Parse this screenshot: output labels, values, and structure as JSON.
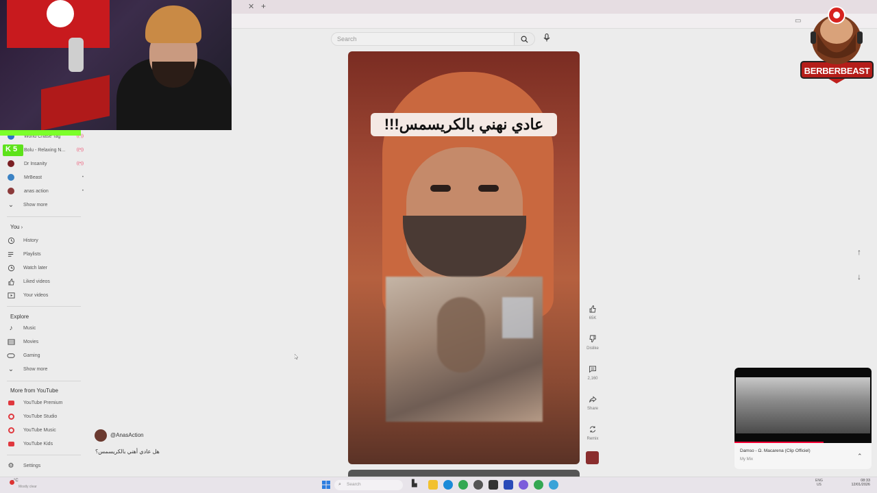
{
  "header": {
    "search_placeholder": "Search"
  },
  "overlay": {
    "brand": "BERBERBEAST",
    "kick_label": "5"
  },
  "sidebar": {
    "subscriptions": [
      {
        "label": "World Chase Tag",
        "color": "#2d72c9",
        "live": "((•))"
      },
      {
        "label": "Bolu - Relaxing N...",
        "color": "#5a5a5a",
        "live": "((•))"
      },
      {
        "label": "Dr Insanity",
        "color": "#7a1f24",
        "live": "((•))"
      },
      {
        "label": "MrBeast",
        "color": "#3b82c4",
        "live": "•"
      },
      {
        "label": "anas action",
        "color": "#8b3a3a",
        "live": "•"
      }
    ],
    "show_more_1": "Show more",
    "you_title": "You",
    "you_items": [
      {
        "label": "History",
        "icon": "history-icon"
      },
      {
        "label": "Playlists",
        "icon": "playlists-icon"
      },
      {
        "label": "Watch later",
        "icon": "watch-later-icon"
      },
      {
        "label": "Liked videos",
        "icon": "liked-videos-icon"
      },
      {
        "label": "Your videos",
        "icon": "your-videos-icon"
      }
    ],
    "explore_title": "Explore",
    "explore_items": [
      {
        "label": "Music",
        "icon": "music-icon"
      },
      {
        "label": "Movies",
        "icon": "movies-icon"
      },
      {
        "label": "Gaming",
        "icon": "gaming-icon"
      }
    ],
    "show_more_2": "Show more",
    "more_title": "More from YouTube",
    "more_items": [
      {
        "label": "YouTube Premium"
      },
      {
        "label": "YouTube Studio"
      },
      {
        "label": "YouTube Music"
      },
      {
        "label": "YouTube Kids"
      }
    ],
    "settings": "Settings"
  },
  "short": {
    "caption": "عادي نهني بالكريسمس!!!",
    "channel": "@AnasAction",
    "title": "هل عادي أهني بالكريسمس؟",
    "likes": "65K",
    "dislike": "Dislike",
    "comments": "2,160",
    "share": "Share",
    "remix": "Remix"
  },
  "miniplayer": {
    "title": "Damso - Ω. Macarena (Clip Officiel)",
    "subtitle": "My Mix",
    "progress": 0.65
  },
  "taskbar": {
    "weather_temp": "-°C",
    "weather_sub": "Mostly clear",
    "search": "Search",
    "lang": "ENG",
    "lang_sub": "US",
    "time": "08:33",
    "date": "12/01/2026"
  },
  "colors": {
    "youtube_red": "#e0383e",
    "kick_green": "#5de21a",
    "background": "#ececec"
  }
}
